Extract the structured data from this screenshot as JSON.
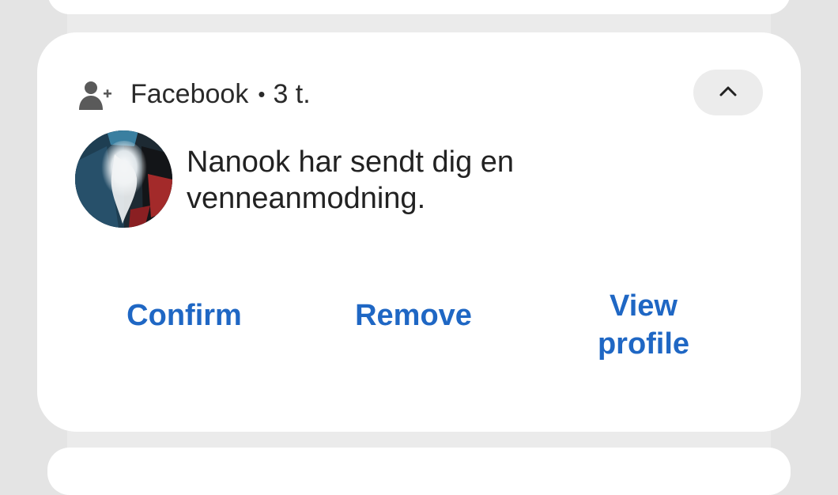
{
  "notification": {
    "app_icon": "add-friend-icon",
    "app_name": "Facebook",
    "separator": "•",
    "time": "3 t.",
    "collapse_icon": "chevron-up-icon",
    "message": "Nanook har sendt dig en venneanmodning.",
    "avatar": "user-avatar"
  },
  "actions": {
    "confirm_label": "Confirm",
    "remove_label": "Remove",
    "view_profile_label": "View profile"
  },
  "colors": {
    "accent": "#1f67c4",
    "card": "#ffffff",
    "background": "#e4e4e4"
  }
}
